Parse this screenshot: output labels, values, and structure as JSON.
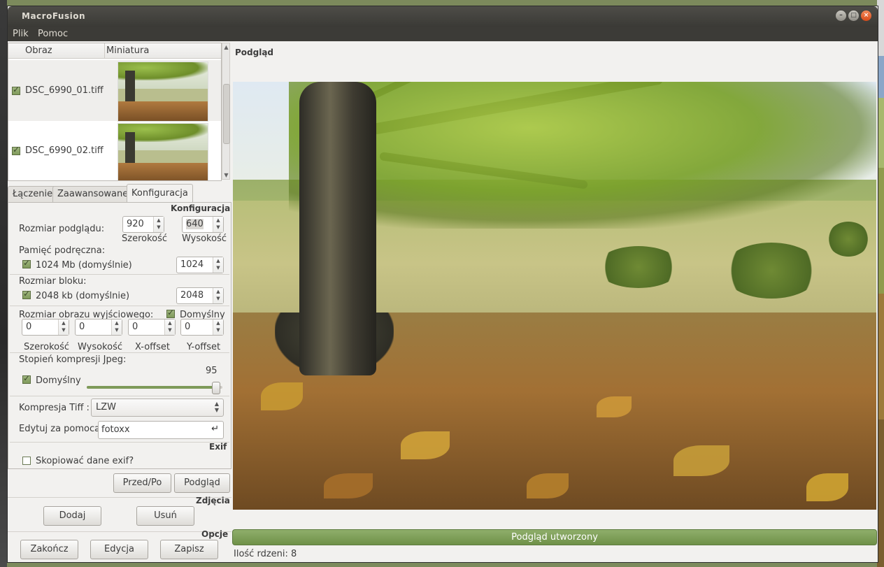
{
  "window": {
    "title": "MacroFusion"
  },
  "menu": [
    "Plik",
    "Pomoc"
  ],
  "file_table": {
    "headers": [
      "Obraz",
      "Miniatura"
    ],
    "rows": [
      {
        "checked": true,
        "name": "DSC_6990_01.tiff"
      },
      {
        "checked": true,
        "name": "DSC_6990_02.tiff"
      }
    ]
  },
  "tabs": [
    "Łączenie",
    "Zaawansowane",
    "Konfiguracja"
  ],
  "active_tab": "Konfiguracja",
  "config": {
    "section_title": "Konfiguracja",
    "preview_size_label": "Rozmiar podglądu:",
    "preview_width": "920",
    "preview_height": "640",
    "width_caption": "Szerokość",
    "height_caption": "Wysokość",
    "cache_label": "Pamięć podręczna:",
    "cache_default_label": "1024 Mb (domyślnie)",
    "cache_default_checked": true,
    "cache_value": "1024",
    "block_label": "Rozmiar bloku:",
    "block_default_label": "2048 kb (domyślnie)",
    "block_default_checked": true,
    "block_value": "2048",
    "output_size_label": "Rozmiar obrazu wyjściowego:",
    "output_default_label": "Domyślny",
    "output_default_checked": true,
    "output_fields": [
      {
        "value": "0",
        "caption": "Szerokość"
      },
      {
        "value": "0",
        "caption": "Wysokość"
      },
      {
        "value": "0",
        "caption": "X-offset"
      },
      {
        "value": "0",
        "caption": "Y-offset"
      }
    ],
    "jpeg_label": "Stopień kompresji Jpeg:",
    "jpeg_value": "95",
    "jpeg_fraction": 0.95,
    "jpeg_default_label": "Domyślny",
    "jpeg_default_checked": true,
    "tiff_label": "Kompresja Tiff :",
    "tiff_value": "LZW",
    "edit_label": "Edytuj za pomocą",
    "edit_value": "fotoxx",
    "exif_title": "Exif",
    "exif_copy_label": "Skopiować dane exif?",
    "exif_copy_checked": false
  },
  "buttons": {
    "before_after": "Przed/Po",
    "preview": "Podgląd",
    "photos_title": "Zdjęcia",
    "add": "Dodaj",
    "remove": "Usuń",
    "options_title": "Opcje",
    "quit": "Zakończ",
    "edit": "Edycja",
    "save": "Zapisz"
  },
  "preview": {
    "title": "Podgląd",
    "status_bar": "Podgląd utworzony",
    "progress_fraction": 1.0,
    "cores_label": "Ilość rdzeni: 8"
  },
  "colors": {
    "titlebar": "#3c3b37",
    "accent_green": "#7e9a59",
    "window_bg": "#f2f1ef",
    "close_button": "#e05a23"
  }
}
